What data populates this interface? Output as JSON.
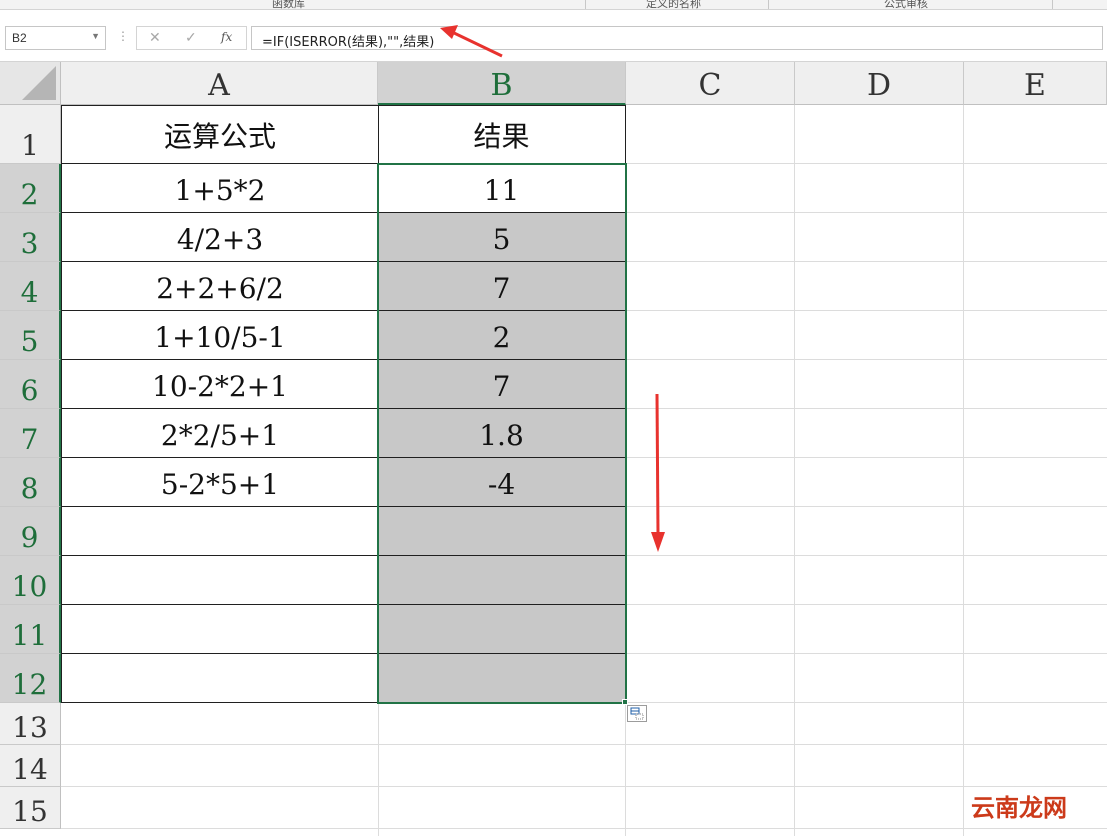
{
  "ribbon": {
    "groups": [
      "函数库",
      "定义的名称",
      "公式审核"
    ]
  },
  "formula_bar": {
    "name_box": "B2",
    "cancel_icon": "✕",
    "enter_icon": "✓",
    "fx_label": "fx",
    "formula": "=IF(ISERROR(结果),\"\",结果)"
  },
  "sheet": {
    "columns": [
      "A",
      "B",
      "C",
      "D",
      "E"
    ],
    "selected_column": "B",
    "rows": [
      "1",
      "2",
      "3",
      "4",
      "5",
      "6",
      "7",
      "8",
      "9",
      "10",
      "11",
      "12",
      "13",
      "14",
      "15"
    ],
    "selected_rows": [
      "2",
      "3",
      "4",
      "5",
      "6",
      "7",
      "8",
      "9",
      "10",
      "11",
      "12"
    ],
    "header_row": {
      "a": "运算公式",
      "b": "结果"
    },
    "data_rows": [
      {
        "a": "1+5*2",
        "b": "11"
      },
      {
        "a": "4/2+3",
        "b": "5"
      },
      {
        "a": "2+2+6/2",
        "b": "7"
      },
      {
        "a": "1+10/5-1",
        "b": "2"
      },
      {
        "a": "10-2*2+1",
        "b": "7"
      },
      {
        "a": "2*2/5+1",
        "b": "1.8"
      },
      {
        "a": "5-2*5+1",
        "b": "-4"
      },
      {
        "a": "",
        "b": ""
      },
      {
        "a": "",
        "b": ""
      },
      {
        "a": "",
        "b": ""
      },
      {
        "a": "",
        "b": ""
      }
    ]
  },
  "colors": {
    "selection": "#217346",
    "range_fill": "#c8c8c8",
    "annotation": "#e8322e"
  },
  "watermark": "云南龙网"
}
